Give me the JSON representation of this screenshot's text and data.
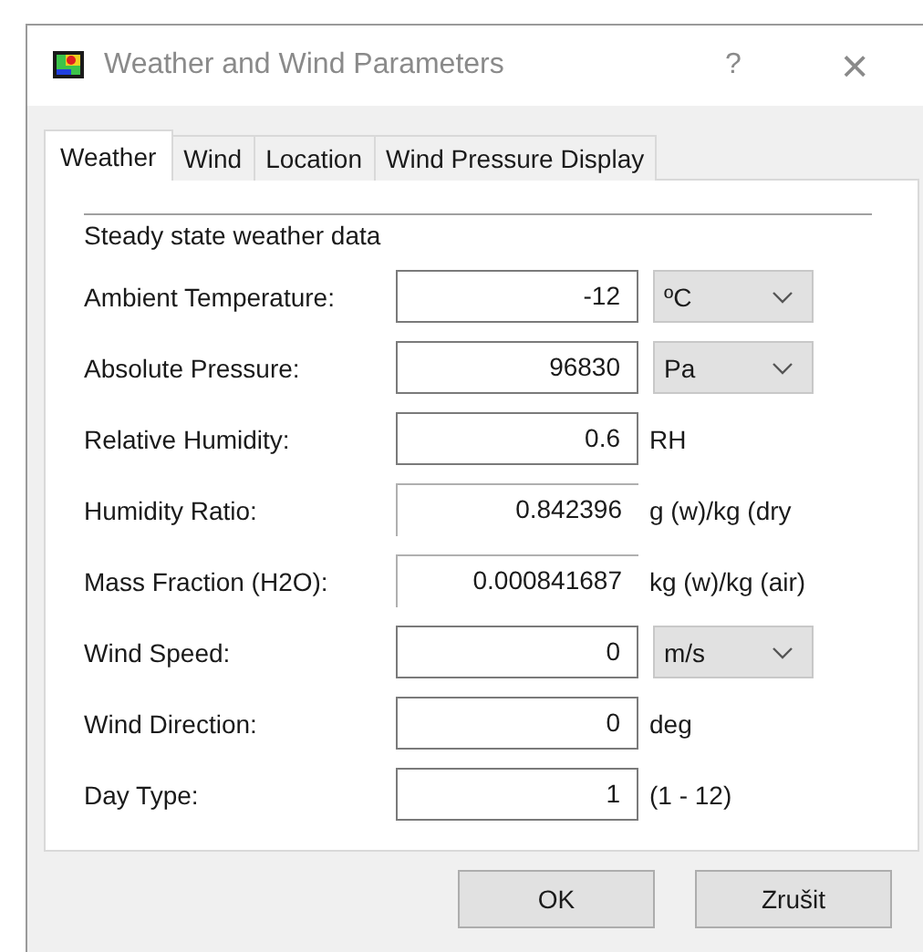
{
  "window": {
    "title": "Weather and Wind Parameters",
    "help": "?",
    "close": "×"
  },
  "tabs": [
    {
      "label": "Weather",
      "selected": true
    },
    {
      "label": "Wind",
      "selected": false
    },
    {
      "label": "Location",
      "selected": false
    },
    {
      "label": "Wind Pressure Display",
      "selected": false
    }
  ],
  "group": {
    "title": "Steady state weather data"
  },
  "rows": [
    {
      "kind": "dropdown",
      "label": "Ambient Temperature:",
      "value": "-12",
      "readonly": false,
      "unit": "ºC"
    },
    {
      "kind": "dropdown",
      "label": "Absolute Pressure:",
      "value": "96830",
      "readonly": false,
      "unit": "Pa"
    },
    {
      "kind": "text",
      "label": "Relative Humidity:",
      "value": "0.6",
      "readonly": false,
      "unit": "RH"
    },
    {
      "kind": "text",
      "label": "Humidity Ratio:",
      "value": "0.842396",
      "readonly": true,
      "unit": "g (w)/kg (dry"
    },
    {
      "kind": "text",
      "label": "Mass Fraction (H2O):",
      "value": "0.000841687",
      "readonly": true,
      "unit": "kg (w)/kg (air)"
    },
    {
      "kind": "dropdown",
      "label": "Wind Speed:",
      "value": "0",
      "readonly": false,
      "unit": "m/s"
    },
    {
      "kind": "text",
      "label": "Wind Direction:",
      "value": "0",
      "readonly": false,
      "unit": "deg"
    },
    {
      "kind": "text",
      "label": "Day Type:",
      "value": "1",
      "readonly": false,
      "unit": "(1 - 12)"
    }
  ],
  "buttons": [
    "OK",
    "Zrušit"
  ]
}
